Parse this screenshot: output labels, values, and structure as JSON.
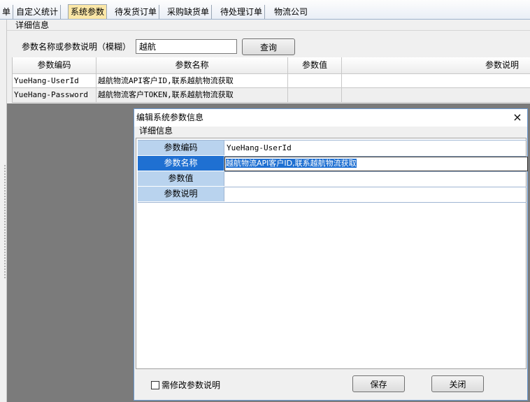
{
  "tabs": [
    {
      "label": "单"
    },
    {
      "label": "自定义统计"
    },
    {
      "label": "系统参数"
    },
    {
      "label": "待发货订单"
    },
    {
      "label": "采购缺货单"
    },
    {
      "label": "待处理订单"
    },
    {
      "label": "物流公司"
    }
  ],
  "active_tab": "系统参数",
  "detail": {
    "title": "详细信息",
    "search_label": "参数名称或参数说明（模糊）",
    "search_value": "越航",
    "query_button": "查询"
  },
  "grid": {
    "columns": [
      "参数编码",
      "参数名称",
      "参数值",
      "参数说明"
    ],
    "rows": [
      [
        "YueHang-UserId",
        "越航物流API客户ID,联系越航物流获取",
        "",
        ""
      ],
      [
        "YueHang-Password",
        "越航物流客户TOKEN,联系越航物流获取",
        "",
        ""
      ]
    ]
  },
  "dialog": {
    "title": "编辑系统参数信息",
    "close_icon": "×",
    "section": "详细信息",
    "fields": [
      {
        "label": "参数编码",
        "value": "YueHang-UserId"
      },
      {
        "label": "参数名称",
        "value": "越航物流API客户ID,联系越航物流获取"
      },
      {
        "label": "参数值",
        "value": ""
      },
      {
        "label": "参数说明",
        "value": ""
      }
    ],
    "checkbox_label": "需修改参数说明",
    "checkbox_checked": false,
    "save_button": "保存",
    "close_button": "关闭"
  },
  "colors": {
    "active_tab": "#fbe7a7",
    "label_cell": "#b9d3ee",
    "selection": "#1f70d2",
    "modal_backdrop": "#7b7b7b"
  }
}
